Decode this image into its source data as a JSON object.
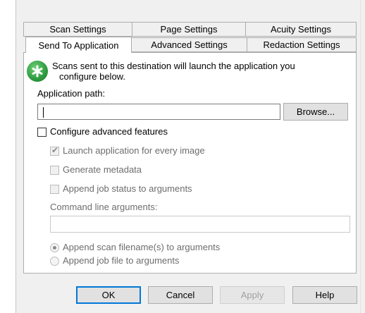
{
  "tabs": {
    "row1": [
      "Scan Settings",
      "Page Settings",
      "Acuity Settings"
    ],
    "row2": [
      "Send To Application",
      "Advanced Settings",
      "Redaction Settings"
    ],
    "active": "Send To Application"
  },
  "info": {
    "icon": "green-star-icon",
    "line1": "Scans sent to this destination will launch the application you",
    "line2": "configure below."
  },
  "app_path": {
    "label": "Application path:",
    "value": "",
    "browse_label": "Browse..."
  },
  "advanced": {
    "checkbox_label": "Configure advanced features",
    "checked": false,
    "launch_every_image": {
      "label": "Launch application for every image",
      "checked": true
    },
    "generate_metadata": {
      "label": "Generate metadata",
      "checked": false
    },
    "append_job_status": {
      "label": "Append job status to arguments",
      "checked": false
    },
    "command_line_label": "Command line arguments:",
    "command_line_value": "",
    "radio_scan_filenames": {
      "label": "Append scan filename(s) to arguments",
      "selected": true
    },
    "radio_job_file": {
      "label": "Append job file to arguments",
      "selected": false
    }
  },
  "buttons": {
    "ok": "OK",
    "cancel": "Cancel",
    "apply": "Apply",
    "help": "Help"
  },
  "colors": {
    "accent": "#0078d7",
    "icon_green": "#2e9a3e",
    "window_bg": "#f0f0f0"
  }
}
